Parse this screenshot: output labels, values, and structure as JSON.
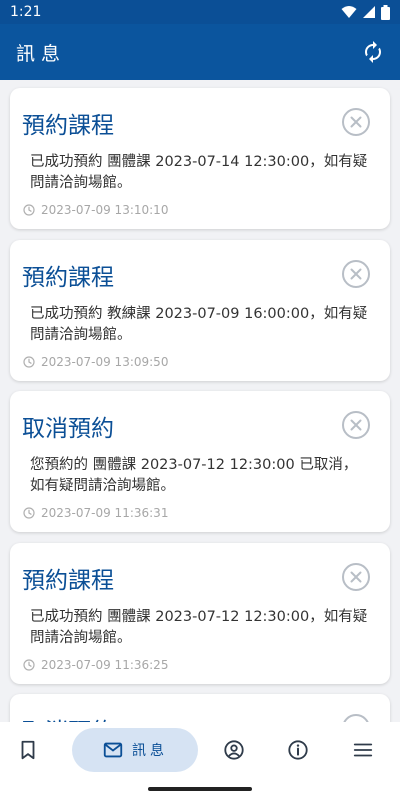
{
  "status_bar": {
    "time": "1:21"
  },
  "app_bar": {
    "title": "訊息"
  },
  "messages": [
    {
      "title": "預約課程",
      "body": "已成功預約 團體課 2023-07-14 12:30:00，如有疑問請洽詢場館。",
      "time": "2023-07-09 13:10:10"
    },
    {
      "title": "預約課程",
      "body": "已成功預約 教練課 2023-07-09 16:00:00，如有疑問請洽詢場館。",
      "time": "2023-07-09 13:09:50"
    },
    {
      "title": "取消預約",
      "body": "您預約的 團體課 2023-07-12 12:30:00 已取消，如有疑問請洽詢場館。",
      "time": "2023-07-09 11:36:31"
    },
    {
      "title": "預約課程",
      "body": "已成功預約 團體課 2023-07-12 12:30:00，如有疑問請洽詢場館。",
      "time": "2023-07-09 11:36:25"
    },
    {
      "title": "取消預約"
    }
  ],
  "bottom_nav": {
    "items": [
      {
        "icon": "bookmark-icon"
      },
      {
        "icon": "mail-icon",
        "label": "訊息",
        "active": true
      },
      {
        "icon": "account-circle-icon"
      },
      {
        "icon": "info-icon"
      },
      {
        "icon": "menu-icon"
      }
    ]
  },
  "colors": {
    "primary": "#0b559e",
    "status_bar": "#0b4f96",
    "title_text": "#0b4f96",
    "background": "#f1f2f5",
    "nav_active_bg": "#d6e3f3",
    "timestamp": "#a7a7a7"
  }
}
